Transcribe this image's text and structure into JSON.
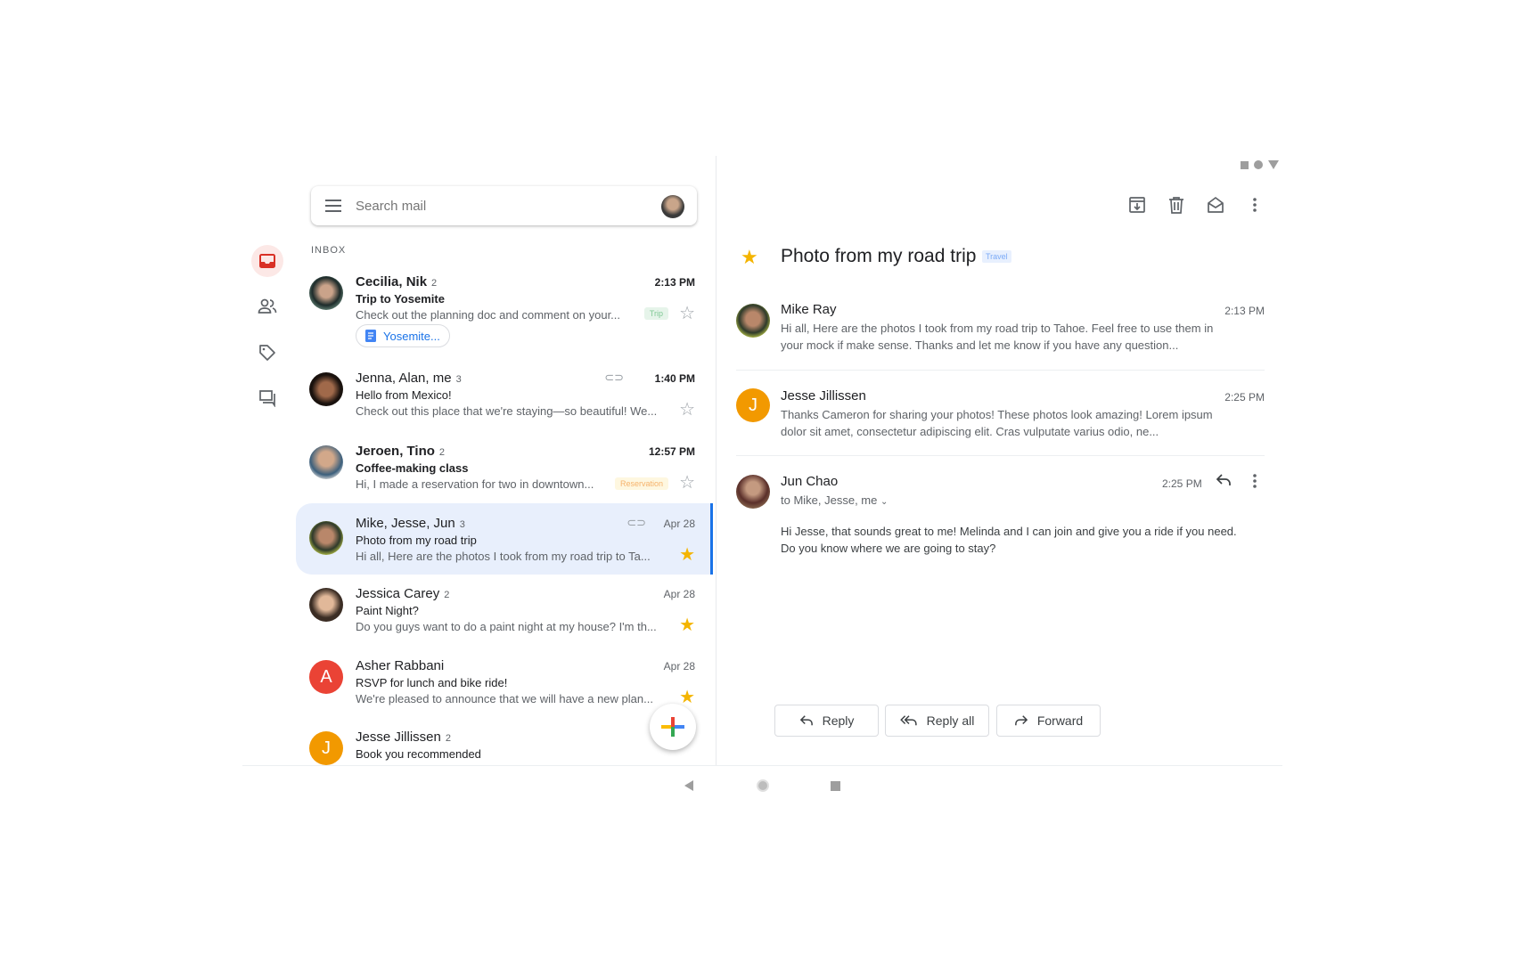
{
  "search": {
    "placeholder": "Search mail"
  },
  "nav": {
    "items": [
      {
        "icon": "inbox-icon",
        "active": true
      },
      {
        "icon": "people-icon"
      },
      {
        "icon": "label-icon"
      },
      {
        "icon": "chat-icon"
      }
    ]
  },
  "list": {
    "section_label": "INBOX",
    "items": [
      {
        "name": "Cecilia, Nik",
        "count": "2",
        "subject": "Trip to Yosemite",
        "snippet": "Check out the planning doc and comment on your...",
        "time": "2:13 PM",
        "tag": "Trip",
        "attachment": "Yosemite...",
        "starred": false,
        "unread": true
      },
      {
        "name": "Jenna, Alan, me",
        "count": "3",
        "subject": "Hello from Mexico!",
        "snippet": "Check out this place that we're staying—so beautiful! We...",
        "time": "1:40 PM",
        "starred": false,
        "unread": true,
        "clip": true
      },
      {
        "name": "Jeroen, Tino",
        "count": "2",
        "subject": "Coffee-making class",
        "snippet": "Hi, I made a reservation for two in downtown...",
        "time": "12:57 PM",
        "tag": "Reservation",
        "starred": false,
        "unread": true
      },
      {
        "name": "Mike, Jesse, Jun",
        "count": "3",
        "subject": "Photo from my road trip",
        "snippet": "Hi all, Here are the photos I took from my road trip to Ta...",
        "time": "Apr 28",
        "starred": true,
        "selected": true,
        "clip": true
      },
      {
        "name": "Jessica Carey",
        "count": "2",
        "subject": "Paint Night?",
        "snippet": "Do you guys want to do a paint night at my house? I'm th...",
        "time": "Apr 28",
        "starred": true
      },
      {
        "name": "Asher Rabbani",
        "initial": "A",
        "subject": "RSVP for lunch and bike ride!",
        "snippet": "We're pleased to announce that we will have a new plan...",
        "time": "Apr 28",
        "starred": true
      },
      {
        "name": "Jesse Jillissen",
        "count": "2",
        "initial": "J",
        "subject": "Book you recommended"
      }
    ]
  },
  "thread": {
    "subject": "Photo from my road trip",
    "label": "Travel",
    "starred": true,
    "messages": [
      {
        "sender": "Mike Ray",
        "time": "2:13 PM",
        "body": "Hi all, Here are the photos I took from my road trip to Tahoe. Feel free to use them in your mock if make sense. Thanks and let me know if you have any question..."
      },
      {
        "sender": "Jesse Jillissen",
        "initial": "J",
        "time": "2:25 PM",
        "body": "Thanks Cameron for sharing your photos! These photos look amazing! Lorem ipsum dolor sit amet, consectetur adipiscing elit. Cras vulputate varius odio, ne..."
      },
      {
        "sender": "Jun Chao",
        "time": "2:25 PM",
        "recipients": "to Mike, Jesse, me",
        "body": "Hi Jesse, that sounds great to me! Melinda and I can join and give you a ride if you need. Do you know where we are going to stay?"
      }
    ],
    "actions": {
      "reply": "Reply",
      "reply_all": "Reply all",
      "forward": "Forward"
    }
  },
  "colors": {
    "accent": "#1a73e8",
    "star": "#f4b400",
    "selected_bg": "#e8effc",
    "inbox_red": "#d93025",
    "avatar_red": "#ea4335",
    "avatar_orange": "#f29900"
  }
}
